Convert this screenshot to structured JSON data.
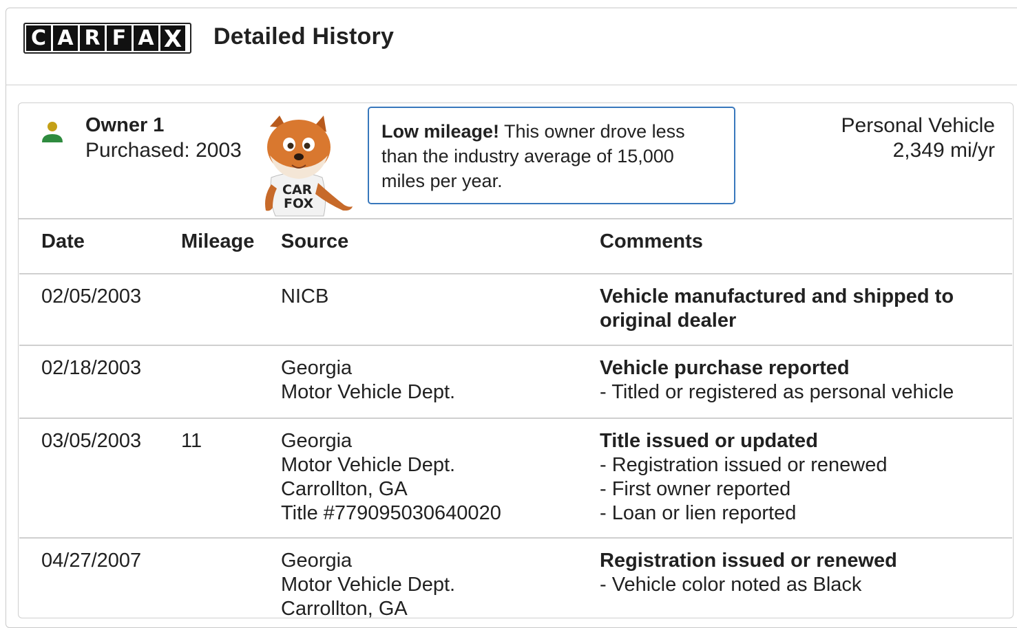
{
  "header": {
    "logo_letters": [
      "C",
      "A",
      "R",
      "F",
      "A",
      "X"
    ],
    "title": "Detailed History"
  },
  "owner": {
    "name": "Owner 1",
    "purchased": "Purchased: 2003",
    "callout_bold": "Low mileage!",
    "callout_text": " This owner drove less than the industry average of 15,000 miles per year.",
    "vehicle_type": "Personal Vehicle",
    "miles_per_year": "2,349 mi/yr",
    "mascot_text": [
      "CAR",
      "FOX"
    ]
  },
  "table": {
    "headers": [
      "Date",
      "Mileage",
      "Source",
      "Comments"
    ],
    "rows": [
      {
        "date": "02/05/2003",
        "mileage": "",
        "source": [
          "NICB"
        ],
        "comment_title": "Vehicle manufactured and shipped to original dealer",
        "comment_items": []
      },
      {
        "date": "02/18/2003",
        "mileage": "",
        "source": [
          "Georgia",
          "Motor Vehicle Dept."
        ],
        "comment_title": "Vehicle purchase reported",
        "comment_items": [
          "- Titled or registered as personal vehicle"
        ]
      },
      {
        "date": "03/05/2003",
        "mileage": "11",
        "source": [
          "Georgia",
          "Motor Vehicle Dept.",
          "Carrollton, GA",
          "Title #779095030640020"
        ],
        "comment_title": "Title issued or updated",
        "comment_items": [
          "- Registration issued or renewed",
          "- First owner reported",
          "- Loan or lien reported"
        ]
      },
      {
        "date": "04/27/2007",
        "mileage": "",
        "source": [
          "Georgia",
          "Motor Vehicle Dept.",
          "Carrollton, GA"
        ],
        "comment_title": "Registration issued or renewed",
        "comment_items": [
          "- Vehicle color noted as Black"
        ]
      }
    ]
  },
  "colors": {
    "callout_border": "#3777bc",
    "person_head": "#c4a017",
    "person_body": "#2e8b3e"
  }
}
